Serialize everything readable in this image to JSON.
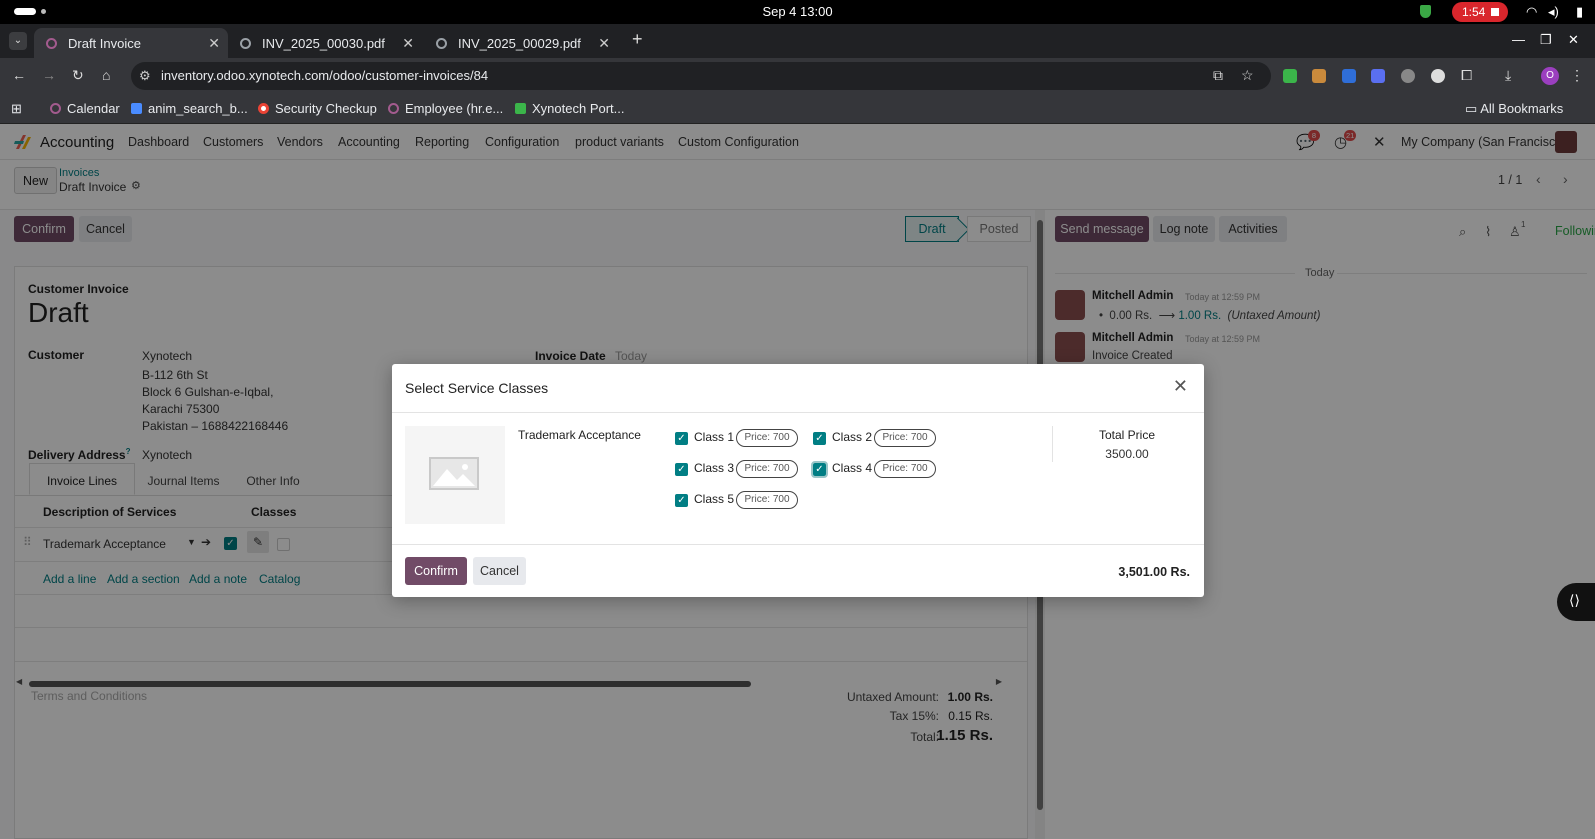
{
  "os": {
    "clock": "Sep 4  13:00",
    "recording": "1:54"
  },
  "browser": {
    "tabs": [
      {
        "label": "Draft Invoice"
      },
      {
        "label": "INV_2025_00030.pdf"
      },
      {
        "label": "INV_2025_00029.pdf"
      }
    ],
    "url": "inventory.odoo.xynotech.com/odoo/customer-invoices/84",
    "profile_initial": "O",
    "bookmarks": [
      {
        "label": "Calendar"
      },
      {
        "label": "anim_search_b..."
      },
      {
        "label": "Security Checkup"
      },
      {
        "label": "Employee (hr.e..."
      },
      {
        "label": "Xynotech Port..."
      }
    ],
    "all_bookmarks": "All Bookmarks"
  },
  "navbar": {
    "app_name": "Accounting",
    "menu": [
      "Dashboard",
      "Customers",
      "Vendors",
      "Accounting",
      "Reporting",
      "Configuration",
      "product variants",
      "Custom Configuration"
    ],
    "messages_badge": "8",
    "activities_badge": "21",
    "company": "My Company (San Francisco)"
  },
  "control": {
    "new_label": "New",
    "breadcrumb_parent": "Invoices",
    "breadcrumb_current": "Draft Invoice",
    "pager": "1 / 1"
  },
  "form": {
    "confirm_label": "Confirm",
    "cancel_label": "Cancel",
    "status": {
      "draft": "Draft",
      "posted": "Posted"
    },
    "type_label": "Customer Invoice",
    "title": "Draft",
    "customer_label": "Customer",
    "customer_lines": [
      "Xynotech",
      "B-112 6th St",
      "Block 6 Gulshan-e-Iqbal,",
      "Karachi 75300",
      "Pakistan – 1688422168446"
    ],
    "invoice_date_label": "Invoice Date",
    "invoice_date_value": "Today",
    "delivery_label": "Delivery Address",
    "delivery_help": "?",
    "delivery_value": "Xynotech",
    "tabs": [
      "Invoice Lines",
      "Journal Items",
      "Other Info"
    ],
    "columns": {
      "description": "Description of Services",
      "classes": "Classes"
    },
    "line": {
      "description": "Trademark Acceptance"
    },
    "add_links": [
      "Add a line",
      "Add a section",
      "Add a note",
      "Catalog"
    ],
    "terms_placeholder": "Terms and Conditions",
    "totals": {
      "untaxed_label": "Untaxed Amount:",
      "untaxed_value": "1.00 Rs.",
      "tax_label": "Tax 15%:",
      "tax_value": "0.15 Rs.",
      "total_label": "Total:",
      "total_value": "1.15 Rs."
    }
  },
  "chatter": {
    "send_message": "Send message",
    "log_note": "Log note",
    "activities": "Activities",
    "followers_count": "1",
    "following": "Following",
    "date_divider": "Today",
    "messages": [
      {
        "author": "Mitchell Admin",
        "time": "Today at 12:59 PM",
        "old": "0.00 Rs.",
        "new": "1.00 Rs.",
        "field": "(Untaxed Amount)"
      },
      {
        "author": "Mitchell Admin",
        "time": "Today at 12:59 PM",
        "body": "Invoice Created"
      }
    ]
  },
  "modal": {
    "title": "Select Service Classes",
    "service_name": "Trademark Acceptance",
    "classes": [
      {
        "label": "Class 1",
        "price": "Price: 700",
        "checked": true
      },
      {
        "label": "Class 2",
        "price": "Price: 700",
        "checked": true
      },
      {
        "label": "Class 3",
        "price": "Price: 700",
        "checked": true
      },
      {
        "label": "Class 4",
        "price": "Price: 700",
        "checked": true
      },
      {
        "label": "Class 5",
        "price": "Price: 700",
        "checked": true
      }
    ],
    "total_price_label": "Total Price",
    "total_price_value": "3500.00",
    "confirm_label": "Confirm",
    "cancel_label": "Cancel",
    "footer_total": "3,501.00 Rs."
  },
  "colors": {
    "primary": "#714b67",
    "teal": "#017e84",
    "following_green": "#28a745",
    "badge_red": "#e14c4c"
  }
}
